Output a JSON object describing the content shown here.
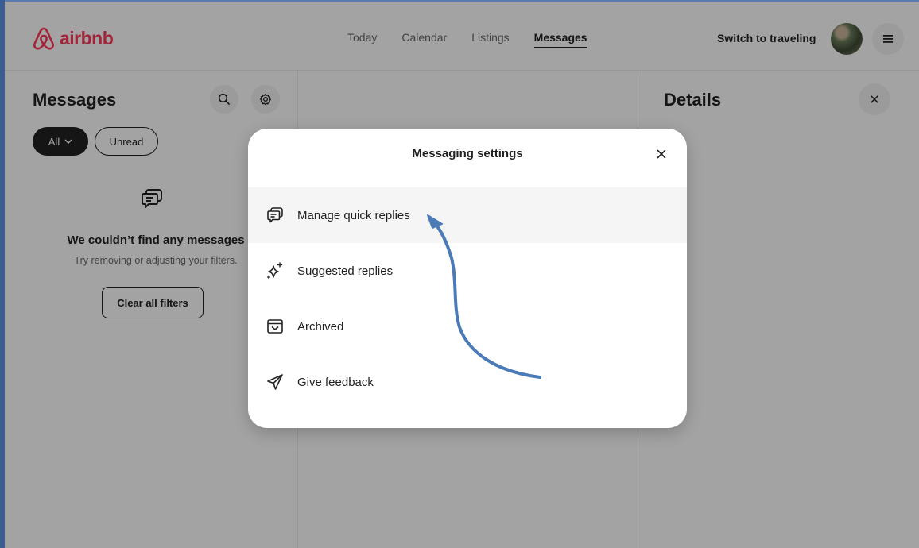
{
  "header": {
    "logo_text": "airbnb",
    "brand_color": "#ff385c",
    "nav": [
      {
        "label": "Today",
        "active": false
      },
      {
        "label": "Calendar",
        "active": false
      },
      {
        "label": "Listings",
        "active": false
      },
      {
        "label": "Messages",
        "active": true
      }
    ],
    "switch_label": "Switch to traveling"
  },
  "messages_panel": {
    "title": "Messages",
    "filters": {
      "all_label": "All",
      "unread_label": "Unread"
    },
    "empty": {
      "title": "We couldn’t find any messages",
      "subtitle": "Try removing or adjusting your filters.",
      "clear_label": "Clear all filters"
    }
  },
  "details_panel": {
    "title": "Details"
  },
  "modal": {
    "title": "Messaging settings",
    "items": [
      {
        "label": "Manage quick replies",
        "icon": "chat-bubbles-icon"
      },
      {
        "label": "Suggested replies",
        "icon": "sparkle-icon"
      },
      {
        "label": "Archived",
        "icon": "archive-box-icon"
      },
      {
        "label": "Give feedback",
        "icon": "send-arrow-icon"
      }
    ]
  },
  "annotation": {
    "arrow_color": "#4a7ab8"
  }
}
